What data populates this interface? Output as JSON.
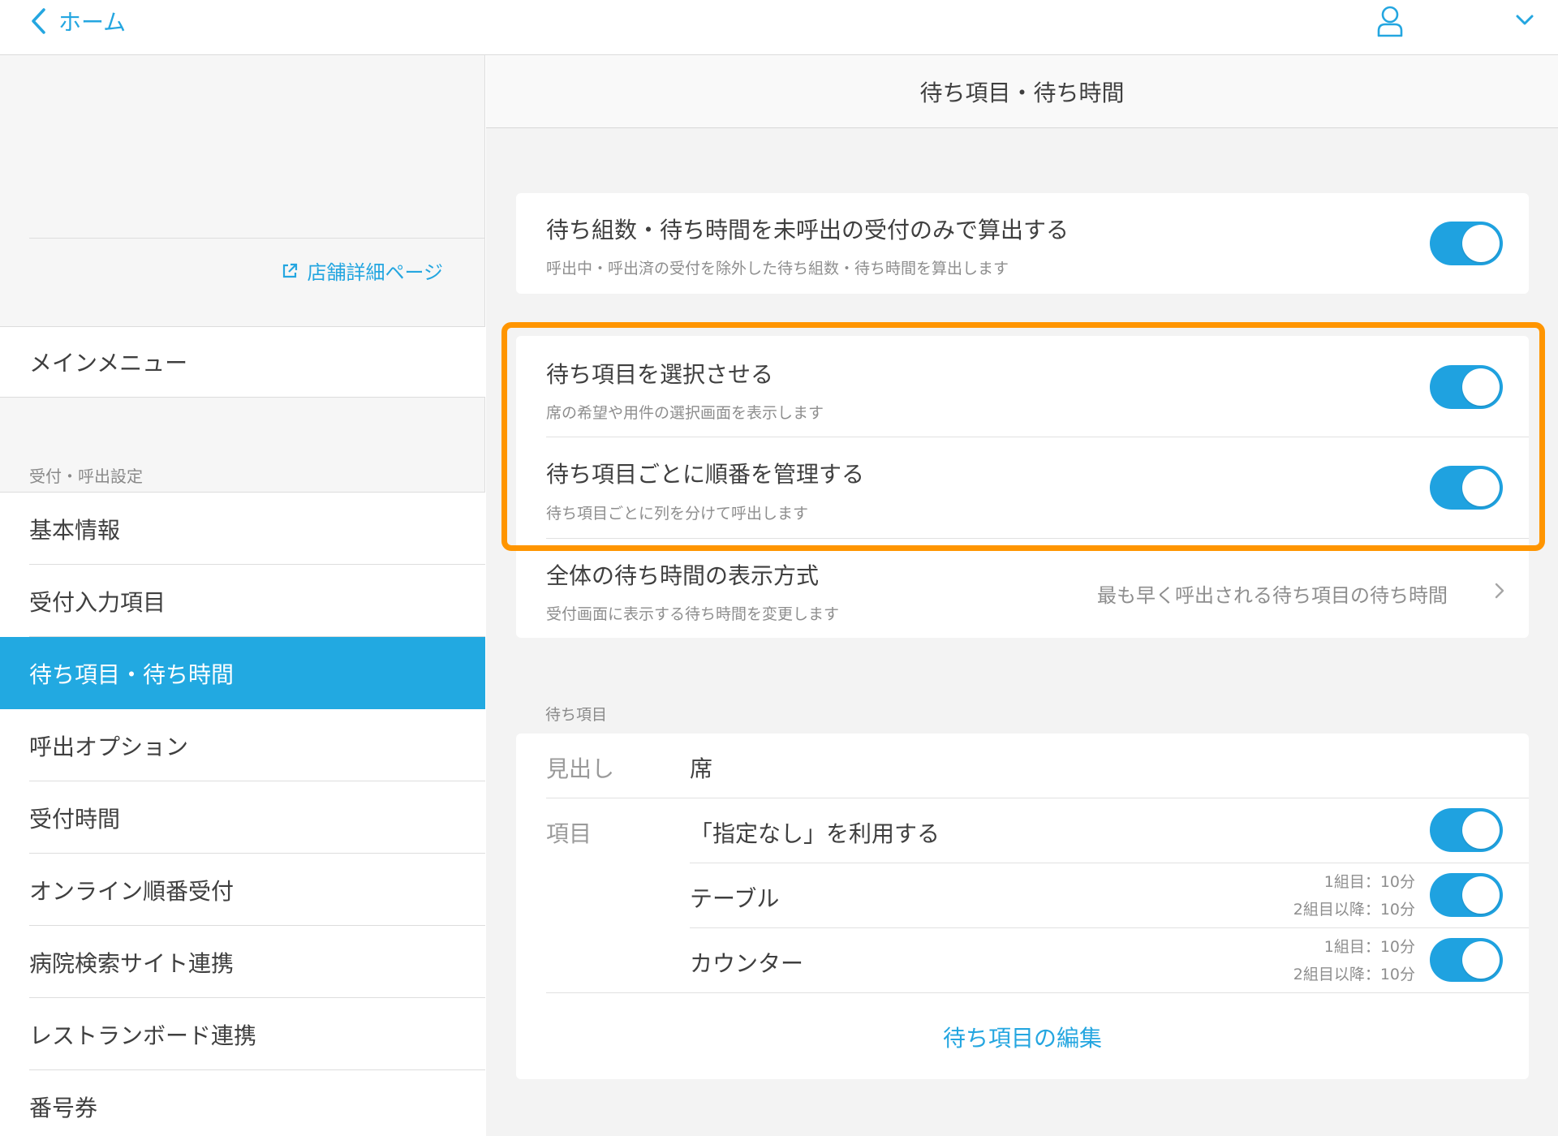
{
  "topbar": {
    "back_label": "ホーム",
    "icons": [
      "chevron-left-icon",
      "user-icon",
      "chevron-down-icon"
    ]
  },
  "sidebar": {
    "store_link": "店舗詳細ページ",
    "main_menu": "メインメニュー",
    "section_label": "受付・呼出設定",
    "items": [
      {
        "label": "基本情報",
        "active": false
      },
      {
        "label": "受付入力項目",
        "active": false
      },
      {
        "label": "待ち項目・待ち時間",
        "active": true
      },
      {
        "label": "呼出オプション",
        "active": false
      },
      {
        "label": "受付時間",
        "active": false
      },
      {
        "label": "オンライン順番受付",
        "active": false
      },
      {
        "label": "病院検索サイト連携",
        "active": false
      },
      {
        "label": "レストランボード連携",
        "active": false
      },
      {
        "label": "番号券",
        "active": false
      }
    ]
  },
  "main": {
    "title": "待ち項目・待ち時間",
    "settings": [
      {
        "title": "待ち組数・待ち時間を未呼出の受付のみで算出する",
        "subtitle": "呼出中・呼出済の受付を除外した待ち組数・待ち時間を算出します",
        "enabled": true
      },
      {
        "title": "待ち項目を選択させる",
        "subtitle": "席の希望や用件の選択画面を表示します",
        "enabled": true
      },
      {
        "title": "待ち項目ごとに順番を管理する",
        "subtitle": "待ち項目ごとに列を分けて呼出します",
        "enabled": true
      }
    ],
    "display_mode": {
      "title": "全体の待ち時間の表示方式",
      "subtitle": "受付画面に表示する待ち時間を変更します",
      "value": "最も早く呼出される待ち項目の待ち時間"
    },
    "wait_items_section": {
      "caption": "待ち項目",
      "heading_label": "見出し",
      "heading_value": "席",
      "items_label": "項目",
      "items": [
        {
          "name": "「指定なし」を利用する",
          "enabled": true
        },
        {
          "name": "テーブル",
          "first": "1組目：10分",
          "after": "2組目以降：10分",
          "enabled": true
        },
        {
          "name": "カウンター",
          "first": "1組目：10分",
          "after": "2組目以降：10分",
          "enabled": true
        }
      ],
      "edit_link": "待ち項目の編集"
    }
  },
  "colors": {
    "accent": "#22a9e1",
    "highlight": "#ff9500"
  }
}
